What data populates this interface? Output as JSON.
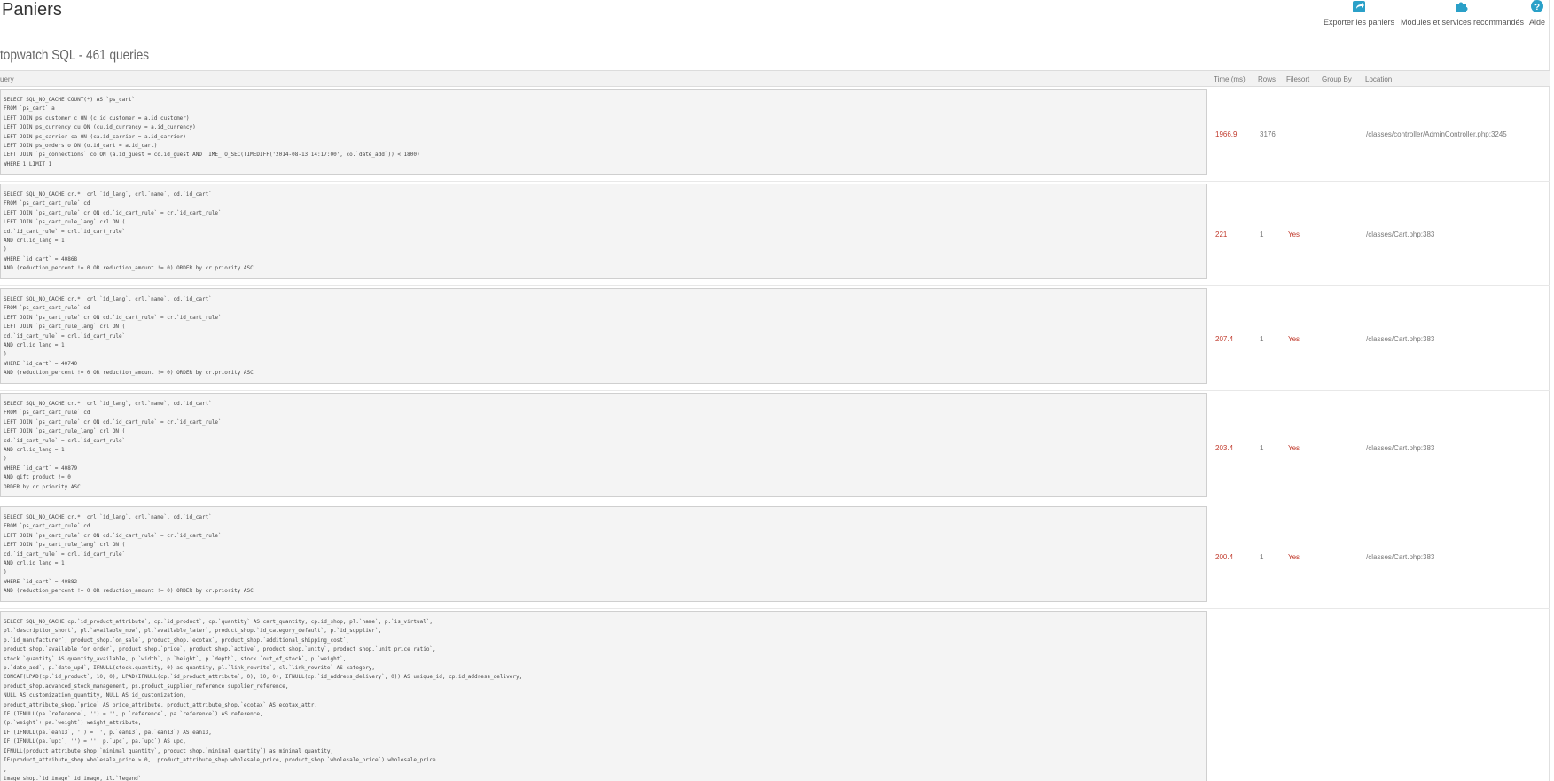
{
  "header": {
    "title": "Paniers",
    "toolbar": {
      "export_label": "Exporter les paniers",
      "modules_label": "Modules et services recommandés",
      "help_label": "Aide"
    }
  },
  "section": {
    "title": "topwatch SQL - 461 queries"
  },
  "table": {
    "columns": {
      "query": "uery",
      "time": "Time (ms)",
      "rows": "Rows",
      "filesort": "Filesort",
      "group_by": "Group By",
      "location": "Location"
    },
    "rows": [
      {
        "query": "SELECT SQL_NO_CACHE COUNT(*) AS `ps_cart`\nFROM `ps_cart` a\nLEFT JOIN ps_customer c ON (c.id_customer = a.id_customer)\nLEFT JOIN ps_currency cu ON (cu.id_currency = a.id_currency)\nLEFT JOIN ps_carrier ca ON (ca.id_carrier = a.id_carrier)\nLEFT JOIN ps_orders o ON (o.id_cart = a.id_cart)\nLEFT JOIN `ps_connections` co ON (a.id_guest = co.id_guest AND TIME_TO_SEC(TIMEDIFF('2014-08-13 14:17:00', co.`date_add`)) < 1800)\nWHERE 1 LIMIT 1",
        "time": "1966.9",
        "rows": "3176",
        "filesort": "",
        "group_by": "",
        "location": "/classes/controller/AdminController.php:3245"
      },
      {
        "query": "SELECT SQL_NO_CACHE cr.*, crl.`id_lang`, crl.`name`, cd.`id_cart`\nFROM `ps_cart_cart_rule` cd\nLEFT JOIN `ps_cart_rule` cr ON cd.`id_cart_rule` = cr.`id_cart_rule`\nLEFT JOIN `ps_cart_rule_lang` crl ON (\ncd.`id_cart_rule` = crl.`id_cart_rule`\nAND crl.id_lang = 1\n)\nWHERE `id_cart` = 40868\nAND (reduction_percent != 0 OR reduction_amount != 0) ORDER by cr.priority ASC",
        "time": "221",
        "rows": "1",
        "filesort": "Yes",
        "group_by": "",
        "location": "/classes/Cart.php:383"
      },
      {
        "query": "SELECT SQL_NO_CACHE cr.*, crl.`id_lang`, crl.`name`, cd.`id_cart`\nFROM `ps_cart_cart_rule` cd\nLEFT JOIN `ps_cart_rule` cr ON cd.`id_cart_rule` = cr.`id_cart_rule`\nLEFT JOIN `ps_cart_rule_lang` crl ON (\ncd.`id_cart_rule` = crl.`id_cart_rule`\nAND crl.id_lang = 1\n)\nWHERE `id_cart` = 40740\nAND (reduction_percent != 0 OR reduction_amount != 0) ORDER by cr.priority ASC",
        "time": "207.4",
        "rows": "1",
        "filesort": "Yes",
        "group_by": "",
        "location": "/classes/Cart.php:383"
      },
      {
        "query": "SELECT SQL_NO_CACHE cr.*, crl.`id_lang`, crl.`name`, cd.`id_cart`\nFROM `ps_cart_cart_rule` cd\nLEFT JOIN `ps_cart_rule` cr ON cd.`id_cart_rule` = cr.`id_cart_rule`\nLEFT JOIN `ps_cart_rule_lang` crl ON (\ncd.`id_cart_rule` = crl.`id_cart_rule`\nAND crl.id_lang = 1\n)\nWHERE `id_cart` = 40879\nAND gift_product != 0\nORDER by cr.priority ASC",
        "time": "203.4",
        "rows": "1",
        "filesort": "Yes",
        "group_by": "",
        "location": "/classes/Cart.php:383"
      },
      {
        "query": "SELECT SQL_NO_CACHE cr.*, crl.`id_lang`, crl.`name`, cd.`id_cart`\nFROM `ps_cart_cart_rule` cd\nLEFT JOIN `ps_cart_rule` cr ON cd.`id_cart_rule` = cr.`id_cart_rule`\nLEFT JOIN `ps_cart_rule_lang` crl ON (\ncd.`id_cart_rule` = crl.`id_cart_rule`\nAND crl.id_lang = 1\n)\nWHERE `id_cart` = 40882\nAND (reduction_percent != 0 OR reduction_amount != 0) ORDER by cr.priority ASC",
        "time": "200.4",
        "rows": "1",
        "filesort": "Yes",
        "group_by": "",
        "location": "/classes/Cart.php:383"
      },
      {
        "query": "SELECT SQL_NO_CACHE cp.`id_product_attribute`, cp.`id_product`, cp.`quantity` AS cart_quantity, cp.id_shop, pl.`name`, p.`is_virtual`,\npl.`description_short`, pl.`available_now`, pl.`available_later`, product_shop.`id_category_default`, p.`id_supplier`,\np.`id_manufacturer`, product_shop.`on_sale`, product_shop.`ecotax`, product_shop.`additional_shipping_cost`,\nproduct_shop.`available_for_order`, product_shop.`price`, product_shop.`active`, product_shop.`unity`, product_shop.`unit_price_ratio`,\nstock.`quantity` AS quantity_available, p.`width`, p.`height`, p.`depth`, stock.`out_of_stock`, p.`weight`,\np.`date_add`, p.`date_upd`, IFNULL(stock.quantity, 0) as quantity, pl.`link_rewrite`, cl.`link_rewrite` AS category,\nCONCAT(LPAD(cp.`id_product`, 10, 0), LPAD(IFNULL(cp.`id_product_attribute`, 0), 10, 0), IFNULL(cp.`id_address_delivery`, 0)) AS unique_id, cp.id_address_delivery,\nproduct_shop.advanced_stock_management, ps.product_supplier_reference supplier_reference,\nNULL AS customization_quantity, NULL AS id_customization,\nproduct_attribute_shop.`price` AS price_attribute, product_attribute_shop.`ecotax` AS ecotax_attr,\nIF (IFNULL(pa.`reference`, '') = '', p.`reference`, pa.`reference`) AS reference,\n(p.`weight`+ pa.`weight`) weight_attribute,\nIF (IFNULL(pa.`ean13`, '') = '', p.`ean13`, pa.`ean13`) AS ean13,\nIF (IFNULL(pa.`upc`, '') = '', p.`upc`, pa.`upc`) AS upc,\nIFNULL(product_attribute_shop.`minimal_quantity`, product_shop.`minimal_quantity`) as minimal_quantity,\nIF(product_attribute_shop.wholesale_price > 0,  product_attribute_shop.wholesale_price, product_shop.`wholesale_price`) wholesale_price\n,\nimage_shop.`id_image` id_image, il.`legend`",
        "time": "",
        "rows": "",
        "filesort": "",
        "group_by": "",
        "location": ""
      }
    ]
  }
}
